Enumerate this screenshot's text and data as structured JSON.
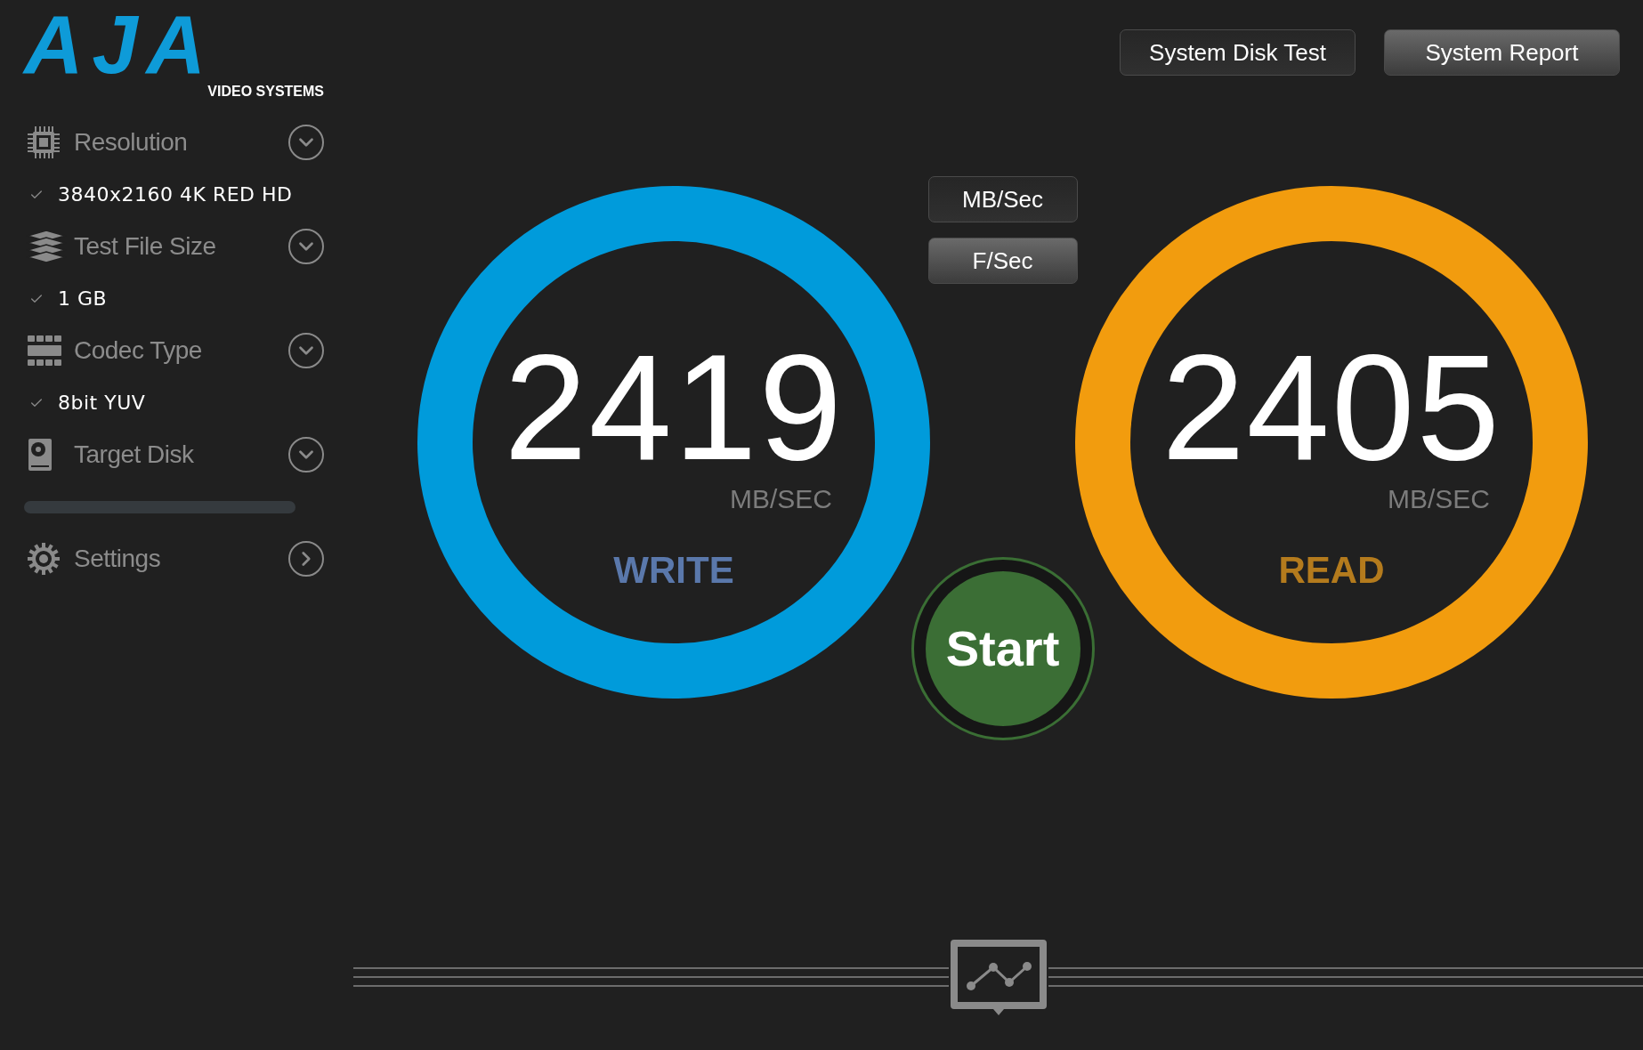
{
  "logo": {
    "wordmark": "AJA",
    "tagline": "VIDEO SYSTEMS"
  },
  "sidebar": {
    "items": [
      {
        "kind": "dropdown",
        "label": "Resolution",
        "value": "3840x2160 4K RED HD"
      },
      {
        "kind": "dropdown",
        "label": "Test File Size",
        "value": "1 GB"
      },
      {
        "kind": "dropdown",
        "label": "Codec Type",
        "value": "8bit YUV"
      },
      {
        "kind": "dropdown",
        "label": "Target Disk",
        "progress_bar": true
      },
      {
        "kind": "link",
        "label": "Settings"
      }
    ]
  },
  "top_buttons": [
    {
      "label": "System Disk Test",
      "selected": true
    },
    {
      "label": "System Report",
      "selected": false
    }
  ],
  "units": [
    {
      "label": "MB/Sec",
      "selected": true
    },
    {
      "label": "F/Sec",
      "selected": false
    }
  ],
  "gauges": [
    {
      "value": "2419",
      "unit": "MB/SEC",
      "label": "WRITE",
      "color": "#009bdb"
    },
    {
      "value": "2405",
      "unit": "MB/SEC",
      "label": "READ",
      "color": "#f29c0e"
    }
  ],
  "start_button": {
    "label": "Start"
  }
}
